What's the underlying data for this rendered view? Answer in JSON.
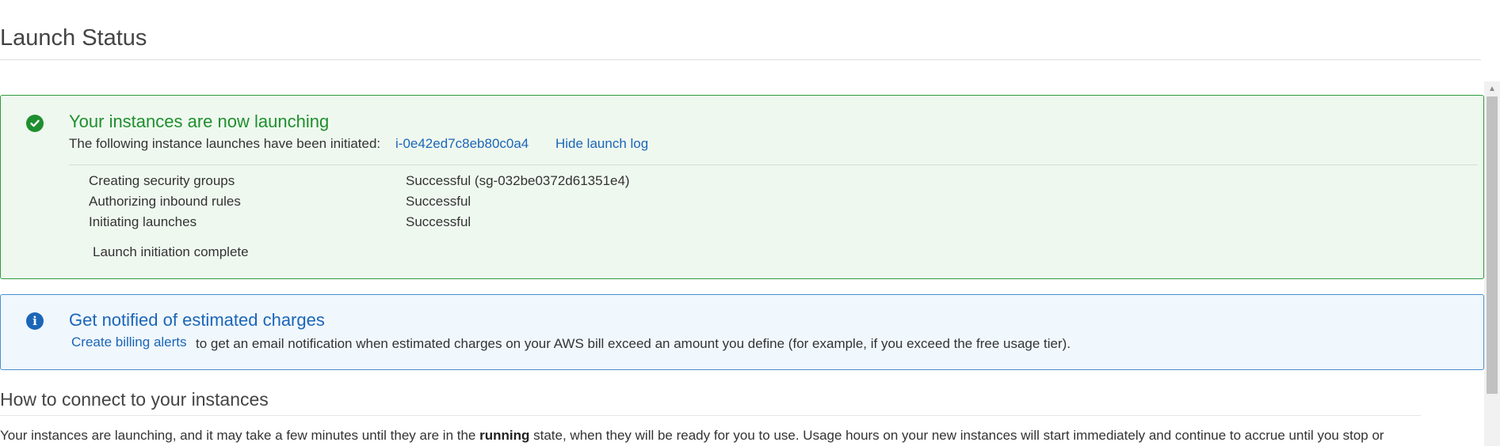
{
  "page": {
    "title": "Launch Status"
  },
  "launch_panel": {
    "heading": "Your instances are now launching",
    "initiated_text": "The following instance launches have been initiated:",
    "instance_id": "i-0e42ed7c8eb80c0a4",
    "hide_log_link": "Hide launch log",
    "log": [
      {
        "step": "Creating security groups",
        "result": "Successful (sg-032be0372d61351e4)"
      },
      {
        "step": "Authorizing inbound rules",
        "result": "Successful"
      },
      {
        "step": "Initiating launches",
        "result": "Successful"
      }
    ],
    "complete_text": "Launch initiation complete"
  },
  "billing_panel": {
    "heading": "Get notified of estimated charges",
    "link": "Create billing alerts",
    "text": "to get an email notification when estimated charges on your AWS bill exceed an amount you define (for example, if you exceed the free usage tier)."
  },
  "connect_section": {
    "heading": "How to connect to your instances",
    "text_before": "Your instances are launching, and it may take a few minutes until they are in the ",
    "text_bold": "running",
    "text_after": " state, when they will be ready for you to use. Usage hours on your new instances will start immediately and continue to accrue until you stop or"
  },
  "colors": {
    "success_green": "#1e8f2e",
    "info_blue": "#1b66b8",
    "success_bg": "#eff8ef",
    "info_bg": "#f0f7fd"
  },
  "icons": {
    "success": "check-circle-icon",
    "info": "info-circle-icon",
    "scroll_up": "scroll-up-arrow-icon"
  }
}
